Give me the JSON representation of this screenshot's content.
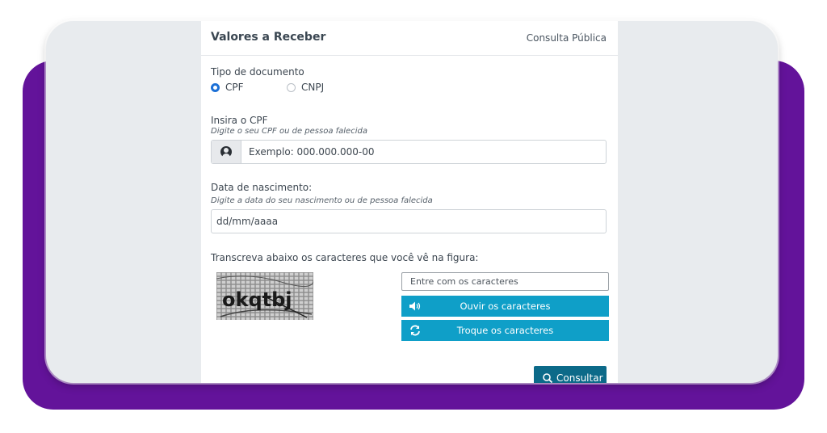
{
  "header": {
    "title": "Valores a Receber",
    "link": "Consulta Pública"
  },
  "document_type": {
    "label": "Tipo de documento",
    "options": [
      {
        "label": "CPF",
        "selected": true
      },
      {
        "label": "CNPJ",
        "selected": false
      }
    ]
  },
  "cpf": {
    "label": "Insira o CPF",
    "hint": "Digite o seu CPF ou de pessoa falecida",
    "placeholder": "Exemplo: 000.000.000-00",
    "icon": "user-circle-icon"
  },
  "birth_date": {
    "label": "Data de nascimento:",
    "hint": "Digite a data do seu nascimento ou de pessoa falecida",
    "placeholder": "dd/mm/aaaa"
  },
  "captcha": {
    "label": "Transcreva abaixo os caracteres que você vê na figura:",
    "image_text": "okqtbj",
    "input_placeholder": "Entre com os caracteres",
    "listen_button": "Ouvir os caracteres",
    "swap_button": "Troque os caracteres"
  },
  "submit": {
    "label": "Consultar",
    "icon": "search-icon"
  },
  "colors": {
    "accent_teal": "#0f9fc8",
    "submit_dark": "#0c6a89",
    "radio_blue": "#1c70d6",
    "frame_purple": "#63139a"
  }
}
